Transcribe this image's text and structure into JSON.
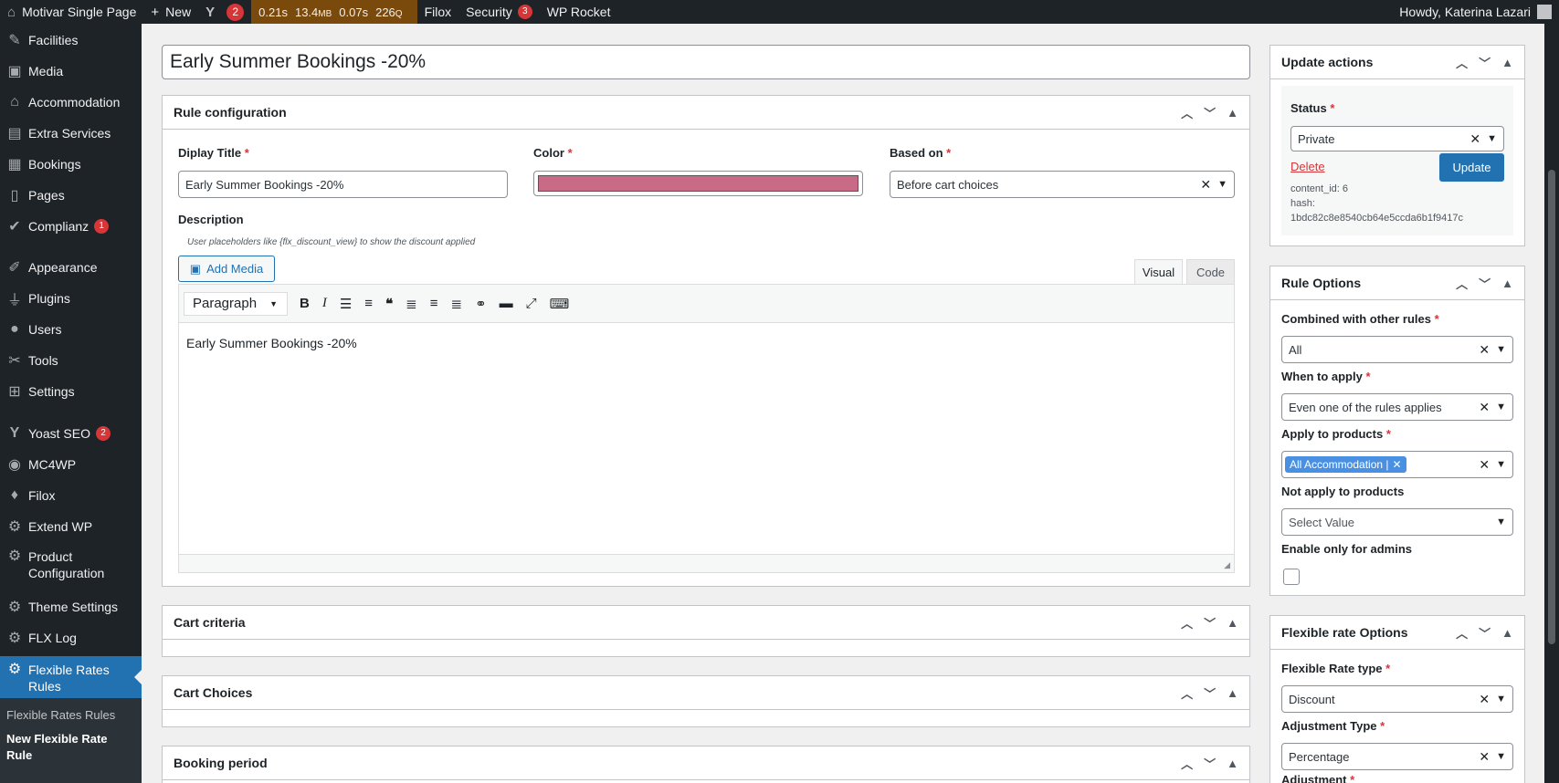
{
  "admin_bar": {
    "site": "Motivar Single Page",
    "new": "New",
    "yoast_count": "2",
    "qm": [
      "0.21s",
      "13.4",
      "MB",
      "0.07s",
      "226",
      "Q"
    ],
    "filox": "Filox",
    "security": "Security",
    "security_count": "3",
    "rocket": "WP Rocket",
    "howdy": "Howdy, Katerina Lazari"
  },
  "sidebar": {
    "items": [
      {
        "label": "Facilities",
        "icon": "pin-icon"
      },
      {
        "label": "Media",
        "icon": "media-icon"
      },
      {
        "label": "Accommodation",
        "icon": "home-icon"
      },
      {
        "label": "Extra Services",
        "icon": "services-icon"
      },
      {
        "label": "Bookings",
        "icon": "calendar-icon"
      },
      {
        "label": "Pages",
        "icon": "pages-icon"
      },
      {
        "label": "Complianz",
        "icon": "check-icon",
        "badge": "1"
      },
      {
        "label": "Appearance",
        "icon": "brush-icon"
      },
      {
        "label": "Plugins",
        "icon": "plugin-icon"
      },
      {
        "label": "Users",
        "icon": "user-icon"
      },
      {
        "label": "Tools",
        "icon": "wrench-icon"
      },
      {
        "label": "Settings",
        "icon": "settings-icon"
      },
      {
        "label": "Yoast SEO",
        "icon": "yoast-icon",
        "badge": "2"
      },
      {
        "label": "MC4WP",
        "icon": "mc4wp-icon"
      },
      {
        "label": "Filox",
        "icon": "filox-icon"
      },
      {
        "label": "Extend WP",
        "icon": "gear-icon"
      },
      {
        "label": "Product Configuration",
        "icon": "gear-icon"
      },
      {
        "label": "Theme Settings",
        "icon": "gear-icon"
      },
      {
        "label": "FLX Log",
        "icon": "gear-icon"
      },
      {
        "label": "Flexible Rates Rules",
        "icon": "gear-icon"
      }
    ],
    "sub": [
      "Flexible Rates Rules",
      "New Flexible Rate Rule"
    ]
  },
  "post_title": "Early Summer Bookings -20%",
  "rule_config": {
    "title": "Rule configuration",
    "display_title_label": "Diplay Title",
    "display_title_value": "Early Summer Bookings -20%",
    "color_label": "Color",
    "color_value": "#c96b86",
    "based_on_label": "Based on",
    "based_on_value": "Before cart choices",
    "description_label": "Description",
    "description_hint": "User placeholders like {flx_discount_view} to show the discount applied",
    "add_media": "Add Media",
    "tab_visual": "Visual",
    "tab_code": "Code",
    "format": "Paragraph",
    "content": "Early Summer Bookings -20%"
  },
  "sections": [
    "Cart criteria",
    "Cart Choices",
    "Booking period"
  ],
  "update": {
    "title": "Update actions",
    "status_label": "Status",
    "status_value": "Private",
    "delete": "Delete",
    "update": "Update",
    "content_id": "content_id: 6",
    "hash_label": "hash:",
    "hash": "1bdc82c8e8540cb64e5ccda6b1f9417c"
  },
  "rule_options": {
    "title": "Rule Options",
    "combined_label": "Combined with other rules",
    "combined_value": "All",
    "when_label": "When to apply",
    "when_value": "Even one of the rules applies",
    "apply_label": "Apply to products",
    "apply_tag": "All Accommodation |",
    "not_apply_label": "Not apply to products",
    "not_apply_placeholder": "Select Value",
    "admins_label": "Enable only for admins"
  },
  "flex_options": {
    "title": "Flexible rate Options",
    "type_label": "Flexible Rate type",
    "type_value": "Discount",
    "adj_type_label": "Adjustment Type",
    "adj_type_value": "Percentage",
    "adj_label": "Adjustment"
  }
}
